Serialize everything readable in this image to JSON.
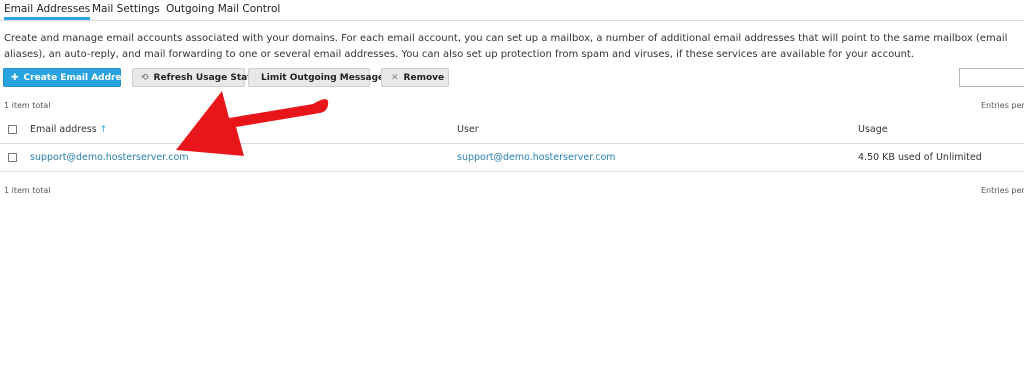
{
  "tabs": [
    {
      "label": "Email Addresses",
      "active": true
    },
    {
      "label": "Mail Settings",
      "active": false
    },
    {
      "label": "Outgoing Mail Control",
      "active": false
    }
  ],
  "description": "Create and manage email accounts associated with your domains. For each email account, you can set up a mailbox, a number of additional email addresses that will point to the same mailbox (email aliases), an auto-reply, and mail forwarding to one or several email addresses. You can also set up protection from spam and viruses, if these services are available for your account.",
  "toolbar": {
    "create_label": "Create Email Address",
    "refresh_label": "Refresh Usage Stats",
    "limit_label": "Limit Outgoing Messages",
    "remove_label": "Remove"
  },
  "search": {
    "placeholder": ""
  },
  "list": {
    "total_top": "1 item total",
    "total_bottom": "1 item total",
    "entries_label_top": "Entries per page",
    "entries_label_bottom": "Entries per page",
    "columns": {
      "email": "Email address",
      "sort_indicator": "↑",
      "user": "User",
      "usage": "Usage"
    },
    "rows": [
      {
        "email": "support@demo.hosterserver.com",
        "user": "support@demo.hosterserver.com",
        "usage": "4.50 KB used of Unlimited"
      }
    ]
  },
  "colors": {
    "accent": "#28a3e0",
    "link": "#2a7fb0",
    "annotation_arrow": "#e8161b"
  },
  "annotation": {
    "type": "arrow",
    "color": "#e8161b"
  }
}
